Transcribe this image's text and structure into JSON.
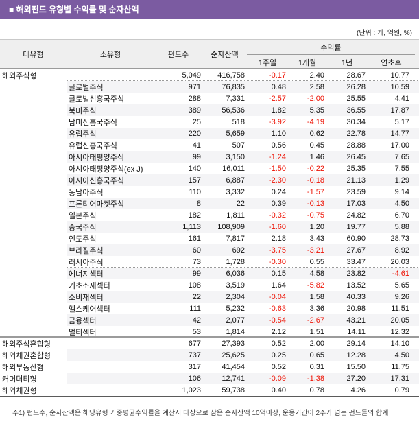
{
  "title": "■ 해외펀드 유형별 수익률 및 순자산액",
  "unit_note": "(단위 : 개, 억원, %)",
  "colors": {
    "accent_purple": "#7b5ba1",
    "negative_red": "#ee1507",
    "header_bg": "#efefef",
    "stripe_bg": "#f4f4f6"
  },
  "table": {
    "headers": {
      "large_type": "대유형",
      "small_type": "소유형",
      "fund_count": "펀드수",
      "net_assets": "순자산액",
      "returns_group": "수익률",
      "sub": [
        "1주일",
        "1개월",
        "1년",
        "연초후"
      ]
    },
    "rows": [
      {
        "large_type": "해외주식형",
        "small_type": "",
        "fund_count": "5,049",
        "net_assets": "416,758",
        "r_1w": "-0.17",
        "r_1m": "2.40",
        "r_1y": "28.67",
        "r_ytd": "10.77",
        "shaded": false,
        "sep_after": "dotted"
      },
      {
        "large_type": "",
        "small_type": "글로벌주식",
        "fund_count": "971",
        "net_assets": "76,835",
        "r_1w": "0.48",
        "r_1m": "2.58",
        "r_1y": "26.28",
        "r_ytd": "10.59",
        "shaded": true,
        "sep_after": ""
      },
      {
        "large_type": "",
        "small_type": "글로벌신흥국주식",
        "fund_count": "288",
        "net_assets": "7,331",
        "r_1w": "-2.57",
        "r_1m": "-2.00",
        "r_1y": "25.55",
        "r_ytd": "4.41",
        "shaded": false,
        "sep_after": ""
      },
      {
        "large_type": "",
        "small_type": "북미주식",
        "fund_count": "389",
        "net_assets": "56,536",
        "r_1w": "1.82",
        "r_1m": "5.35",
        "r_1y": "36.55",
        "r_ytd": "17.87",
        "shaded": true,
        "sep_after": ""
      },
      {
        "large_type": "",
        "small_type": "남미신흥국주식",
        "fund_count": "25",
        "net_assets": "518",
        "r_1w": "-3.92",
        "r_1m": "-4.19",
        "r_1y": "30.34",
        "r_ytd": "5.17",
        "shaded": false,
        "sep_after": ""
      },
      {
        "large_type": "",
        "small_type": "유럽주식",
        "fund_count": "220",
        "net_assets": "5,659",
        "r_1w": "1.10",
        "r_1m": "0.62",
        "r_1y": "22.78",
        "r_ytd": "14.77",
        "shaded": true,
        "sep_after": ""
      },
      {
        "large_type": "",
        "small_type": "유럽신흥국주식",
        "fund_count": "41",
        "net_assets": "507",
        "r_1w": "0.56",
        "r_1m": "0.45",
        "r_1y": "28.88",
        "r_ytd": "17.00",
        "shaded": false,
        "sep_after": ""
      },
      {
        "large_type": "",
        "small_type": "아시아태평양주식",
        "fund_count": "99",
        "net_assets": "3,150",
        "r_1w": "-1.24",
        "r_1m": "1.46",
        "r_1y": "26.45",
        "r_ytd": "7.65",
        "shaded": true,
        "sep_after": ""
      },
      {
        "large_type": "",
        "small_type": "아시아태평양주식(ex J)",
        "fund_count": "140",
        "net_assets": "16,011",
        "r_1w": "-1.50",
        "r_1m": "-0.22",
        "r_1y": "25.35",
        "r_ytd": "7.55",
        "shaded": false,
        "sep_after": ""
      },
      {
        "large_type": "",
        "small_type": "아시아신흥국주식",
        "fund_count": "157",
        "net_assets": "6,887",
        "r_1w": "-2.30",
        "r_1m": "-0.18",
        "r_1y": "21.13",
        "r_ytd": "1.29",
        "shaded": true,
        "sep_after": ""
      },
      {
        "large_type": "",
        "small_type": "동남아주식",
        "fund_count": "110",
        "net_assets": "3,332",
        "r_1w": "0.24",
        "r_1m": "-1.57",
        "r_1y": "23.59",
        "r_ytd": "9.14",
        "shaded": false,
        "sep_after": ""
      },
      {
        "large_type": "",
        "small_type": "프론티어마켓주식",
        "fund_count": "8",
        "net_assets": "22",
        "r_1w": "0.39",
        "r_1m": "-0.13",
        "r_1y": "17.03",
        "r_ytd": "4.50",
        "shaded": true,
        "sep_after": "dotted"
      },
      {
        "large_type": "",
        "small_type": "일본주식",
        "fund_count": "182",
        "net_assets": "1,811",
        "r_1w": "-0.32",
        "r_1m": "-0.75",
        "r_1y": "24.82",
        "r_ytd": "6.70",
        "shaded": false,
        "sep_after": ""
      },
      {
        "large_type": "",
        "small_type": "중국주식",
        "fund_count": "1,113",
        "net_assets": "108,909",
        "r_1w": "-1.60",
        "r_1m": "1.20",
        "r_1y": "19.77",
        "r_ytd": "5.88",
        "shaded": true,
        "sep_after": ""
      },
      {
        "large_type": "",
        "small_type": "인도주식",
        "fund_count": "161",
        "net_assets": "7,817",
        "r_1w": "2.18",
        "r_1m": "3.43",
        "r_1y": "60.90",
        "r_ytd": "28.73",
        "shaded": false,
        "sep_after": ""
      },
      {
        "large_type": "",
        "small_type": "브라질주식",
        "fund_count": "60",
        "net_assets": "692",
        "r_1w": "-3.75",
        "r_1m": "-3.21",
        "r_1y": "27.67",
        "r_ytd": "8.92",
        "shaded": true,
        "sep_after": ""
      },
      {
        "large_type": "",
        "small_type": "러시아주식",
        "fund_count": "73",
        "net_assets": "1,728",
        "r_1w": "-0.30",
        "r_1m": "0.55",
        "r_1y": "33.47",
        "r_ytd": "20.03",
        "shaded": false,
        "sep_after": "dotted"
      },
      {
        "large_type": "",
        "small_type": "에너지섹터",
        "fund_count": "99",
        "net_assets": "6,036",
        "r_1w": "0.15",
        "r_1m": "4.58",
        "r_1y": "23.82",
        "r_ytd": "-4.61",
        "shaded": true,
        "sep_after": ""
      },
      {
        "large_type": "",
        "small_type": "기초소재섹터",
        "fund_count": "108",
        "net_assets": "3,519",
        "r_1w": "1.64",
        "r_1m": "-5.82",
        "r_1y": "13.52",
        "r_ytd": "5.65",
        "shaded": false,
        "sep_after": ""
      },
      {
        "large_type": "",
        "small_type": "소비재섹터",
        "fund_count": "22",
        "net_assets": "2,304",
        "r_1w": "-0.04",
        "r_1m": "1.58",
        "r_1y": "40.33",
        "r_ytd": "9.26",
        "shaded": true,
        "sep_after": ""
      },
      {
        "large_type": "",
        "small_type": "헬스케어섹터",
        "fund_count": "111",
        "net_assets": "5,232",
        "r_1w": "-0.63",
        "r_1m": "3.36",
        "r_1y": "20.98",
        "r_ytd": "11.51",
        "shaded": false,
        "sep_after": ""
      },
      {
        "large_type": "",
        "small_type": "금융섹터",
        "fund_count": "42",
        "net_assets": "2,077",
        "r_1w": "-0.54",
        "r_1m": "-2.67",
        "r_1y": "43.21",
        "r_ytd": "20.05",
        "shaded": true,
        "sep_after": ""
      },
      {
        "large_type": "",
        "small_type": "멀티섹터",
        "fund_count": "53",
        "net_assets": "1,814",
        "r_1w": "2.12",
        "r_1m": "1.51",
        "r_1y": "14.11",
        "r_ytd": "12.32",
        "shaded": false,
        "sep_after": "solid"
      },
      {
        "large_type": "해외주식혼합형",
        "small_type": "",
        "fund_count": "677",
        "net_assets": "27,393",
        "r_1w": "0.52",
        "r_1m": "2.00",
        "r_1y": "29.14",
        "r_ytd": "14.10",
        "shaded": false,
        "sep_after": ""
      },
      {
        "large_type": "해외채권혼합형",
        "small_type": "",
        "fund_count": "737",
        "net_assets": "25,625",
        "r_1w": "0.25",
        "r_1m": "0.65",
        "r_1y": "12.28",
        "r_ytd": "4.50",
        "shaded": true,
        "sep_after": ""
      },
      {
        "large_type": "해외부동산형",
        "small_type": "",
        "fund_count": "317",
        "net_assets": "41,454",
        "r_1w": "0.52",
        "r_1m": "0.31",
        "r_1y": "15.50",
        "r_ytd": "11.75",
        "shaded": false,
        "sep_after": ""
      },
      {
        "large_type": "커머더티형",
        "small_type": "",
        "fund_count": "106",
        "net_assets": "12,741",
        "r_1w": "-0.09",
        "r_1m": "-1.38",
        "r_1y": "27.20",
        "r_ytd": "17.31",
        "shaded": true,
        "sep_after": ""
      },
      {
        "large_type": "해외채권형",
        "small_type": "",
        "fund_count": "1,023",
        "net_assets": "59,738",
        "r_1w": "0.40",
        "r_1m": "0.78",
        "r_1y": "4.26",
        "r_ytd": "0.79",
        "shaded": false,
        "sep_after": ""
      }
    ]
  },
  "footnote": "주1) 펀드수, 순자산액은 해당유형 가중평균수익률을 계산시 대상으로 삼은 순자산액 10억이상, 운용기간이 2주가 넘는 펀드들의 합계"
}
